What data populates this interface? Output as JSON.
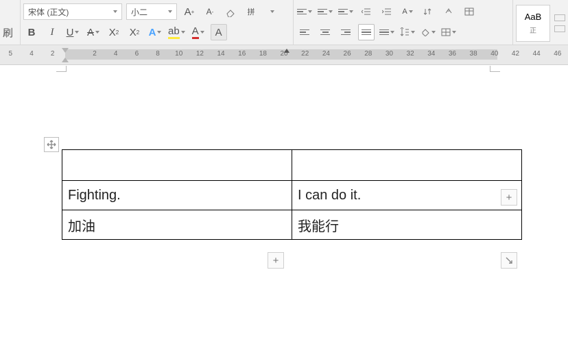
{
  "ribbon": {
    "brush_label": "刷",
    "font_name": "宋体 (正文)",
    "font_size": "小二",
    "bold": "B",
    "italic": "I",
    "style_preview": "AaB"
  },
  "ruler": {
    "numbers": [
      "5",
      "4",
      "2",
      "",
      "2",
      "4",
      "6",
      "8",
      "10",
      "12",
      "14",
      "16",
      "18",
      "20",
      "22",
      "24",
      "26",
      "28",
      "30",
      "32",
      "34",
      "36",
      "38",
      "40",
      "42",
      "44",
      "46"
    ]
  },
  "table": {
    "rows": [
      [
        "",
        ""
      ],
      [
        "Fighting.",
        "I can do it."
      ],
      [
        "加油",
        "我能行"
      ]
    ]
  },
  "handles": {
    "add_col": "+",
    "add_row": "+"
  }
}
